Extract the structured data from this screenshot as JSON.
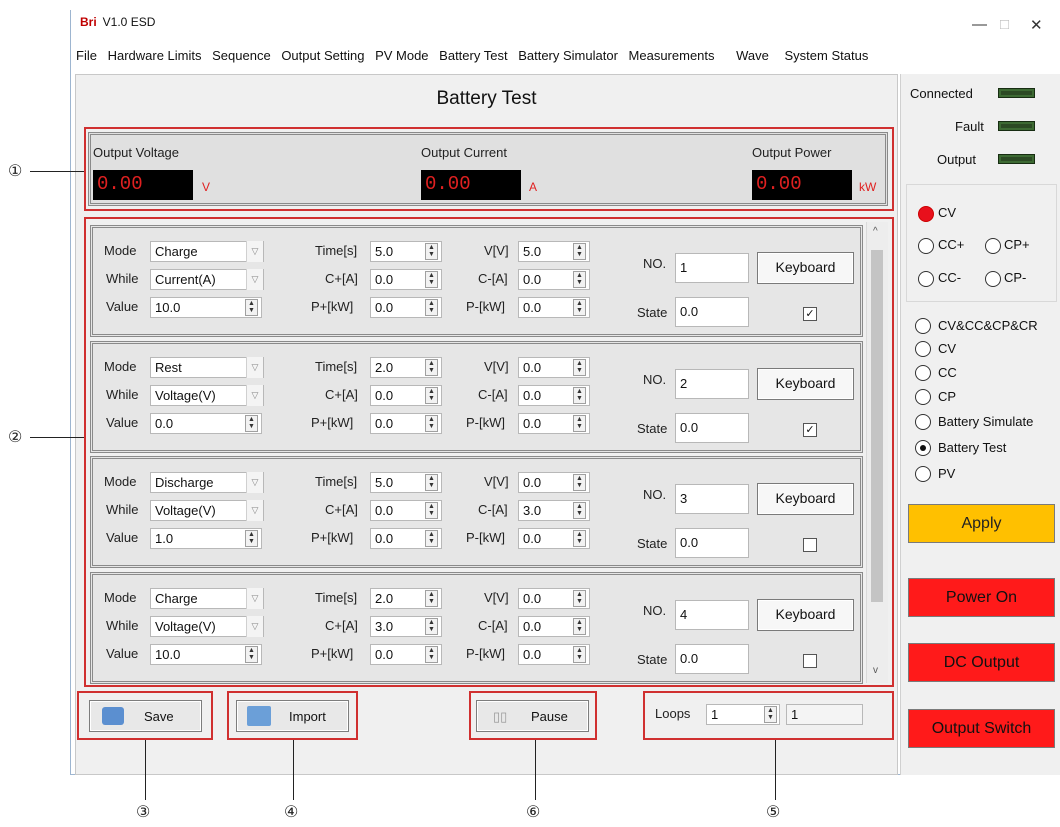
{
  "window": {
    "logo": "Bri",
    "title": "V1.0  ESD",
    "minimize": "—",
    "maximize": "□",
    "close": "✕"
  },
  "menu": [
    "File",
    "Hardware Limits",
    "Sequence",
    "Output Setting",
    "PV Mode",
    "Battery Test",
    "Battery Simulator",
    "Measurements",
    "Wave",
    "System Status"
  ],
  "page_title": "Battery Test",
  "readouts": {
    "voltage": {
      "label": "Output Voltage",
      "value": "0.00",
      "unit": "V"
    },
    "current": {
      "label": "Output Current",
      "value": "0.00",
      "unit": "A"
    },
    "power": {
      "label": "Output Power",
      "value": "0.00",
      "unit": "kW"
    }
  },
  "labels": {
    "mode": "Mode",
    "while": "While",
    "value": "Value",
    "time": "Time[s]",
    "cplus": "C+[A]",
    "pplus": "P+[kW]",
    "v": "V[V]",
    "cminus": "C-[A]",
    "pminus": "P-[kW]",
    "no": "NO.",
    "state": "State",
    "keyboard": "Keyboard"
  },
  "segments": [
    {
      "mode": "Charge",
      "while": "Current(A)",
      "value": "10.0",
      "time": "5.0",
      "cplus": "0.0",
      "pplus": "0.0",
      "v": "5.0",
      "cminus": "0.0",
      "pminus": "0.0",
      "no": "1",
      "state": "0.0",
      "checked": true
    },
    {
      "mode": "Rest",
      "while": "Voltage(V)",
      "value": "0.0",
      "time": "2.0",
      "cplus": "0.0",
      "pplus": "0.0",
      "v": "0.0",
      "cminus": "0.0",
      "pminus": "0.0",
      "no": "2",
      "state": "0.0",
      "checked": true
    },
    {
      "mode": "Discharge",
      "while": "Voltage(V)",
      "value": "1.0",
      "time": "5.0",
      "cplus": "0.0",
      "pplus": "0.0",
      "v": "0.0",
      "cminus": "3.0",
      "pminus": "0.0",
      "no": "3",
      "state": "0.0",
      "checked": false
    },
    {
      "mode": "Charge",
      "while": "Voltage(V)",
      "value": "10.0",
      "time": "2.0",
      "cplus": "3.0",
      "pplus": "0.0",
      "v": "0.0",
      "cminus": "0.0",
      "pminus": "0.0",
      "no": "4",
      "state": "0.0",
      "checked": false
    }
  ],
  "bottom": {
    "save": "Save",
    "import": "Import",
    "pause": "Pause",
    "loops_label": "Loops",
    "loops_value": "1",
    "loops_count": "1"
  },
  "status": {
    "connected": "Connected",
    "fault": "Fault",
    "output": "Output"
  },
  "mode_radios": [
    {
      "label": "CV",
      "selected": true
    },
    {
      "label": "CC+",
      "selected": false
    },
    {
      "label": "CP+",
      "selected": false
    },
    {
      "label": "CC-",
      "selected": false
    },
    {
      "label": "CP-",
      "selected": false
    }
  ],
  "function_radios": [
    {
      "label": "CV&CC&CP&CR",
      "selected": false
    },
    {
      "label": "CV",
      "selected": false
    },
    {
      "label": "CC",
      "selected": false
    },
    {
      "label": "CP",
      "selected": false
    },
    {
      "label": "Battery Simulate",
      "selected": false
    },
    {
      "label": "Battery Test",
      "selected": true
    },
    {
      "label": "PV",
      "selected": false
    }
  ],
  "actions": {
    "apply": "Apply",
    "power_on": "Power On",
    "dc_output": "DC Output",
    "output_switch": "Output Switch"
  },
  "colors": {
    "highlight_box": "#d03030",
    "apply_bg": "#ffc000",
    "action_red": "#ff1a1a"
  },
  "callouts": [
    "①",
    "②",
    "③",
    "④",
    "⑤",
    "⑥"
  ]
}
